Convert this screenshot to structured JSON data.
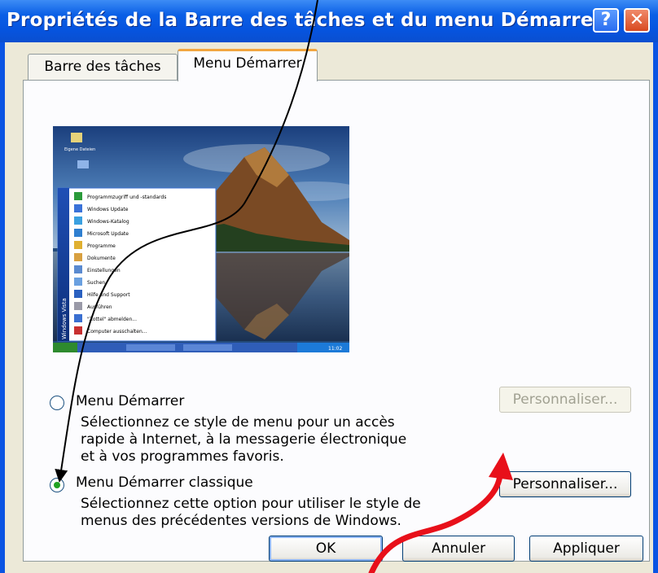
{
  "window": {
    "title": "Propriétés de la Barre des tâches et du menu Démarrer",
    "help_glyph": "?",
    "close_glyph": "✕"
  },
  "tabs": [
    {
      "label": "Barre des tâches",
      "selected": false
    },
    {
      "label": "Menu Démarrer",
      "selected": true
    }
  ],
  "preview": {
    "start_menu_items": [
      "Programmzugriff und -standards",
      "Windows Update",
      "Windows-Katalog",
      "Microsoft Update",
      "Programme",
      "Dokumente",
      "Einstellungen",
      "Suchen",
      "Hilfe und Support",
      "Ausführen",
      "\"Zottel\" abmelden...",
      "Computer ausschalten..."
    ],
    "side_label": "Windows Vista",
    "desktop_icon_label": "Eigene Dateien",
    "clock": "11:02"
  },
  "options": {
    "start_menu": {
      "label": "Menu Démarrer",
      "description_lines": [
        "Sélectionnez ce style de menu pour un accès",
        "rapide à Internet, à la messagerie électronique",
        "et à vos programmes favoris."
      ],
      "customize_label": "Personnaliser...",
      "selected": false
    },
    "classic": {
      "label": "Menu Démarrer classique",
      "description_lines": [
        "Sélectionnez cette option pour utiliser le style de",
        "menus des précédentes versions de Windows."
      ],
      "customize_label": "Personnaliser...",
      "selected": true
    }
  },
  "buttons": {
    "ok": "OK",
    "cancel": "Annuler",
    "apply": "Appliquer"
  },
  "colors": {
    "titlebar": "#0a54e3",
    "dialog_bg": "#ece9d8",
    "tab_accent": "#f2a640",
    "annotation_red": "#e8101a"
  }
}
